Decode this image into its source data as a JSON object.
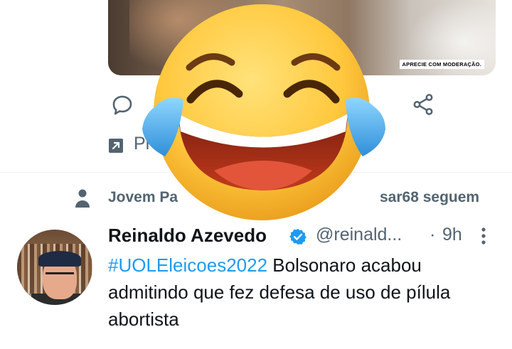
{
  "media": {
    "caption": "APRECIE COM MODERAÇÃO."
  },
  "actions": {
    "reply_icon": "reply-icon",
    "share_icon": "share-icon"
  },
  "promoted": {
    "icon": "promoted-arrow-icon",
    "label_visible": "Pr"
  },
  "social_context": {
    "icon": "person-icon",
    "text_left": "Jovem Pa",
    "text_right": "sar68 seguem"
  },
  "tweet": {
    "author_name": "Reinaldo Azevedo",
    "handle": "@reinald...",
    "separator": "·",
    "time": "9h",
    "hashtag": "#UOLEleicoes2022",
    "text_after_hashtag": " Bolsonaro acabou admitindo que fez defesa de uso de pílula abortista",
    "verified_icon": "verified-badge-icon",
    "more_icon": "more-vertical-icon"
  },
  "overlay": {
    "emoji": "face-with-tears-of-joy-icon"
  },
  "colors": {
    "link": "#1d9bf0",
    "secondary_text": "#536471",
    "primary_text": "#0f1419",
    "verified": "#1d9bf0",
    "emoji_yellow": "#ffc83d"
  }
}
